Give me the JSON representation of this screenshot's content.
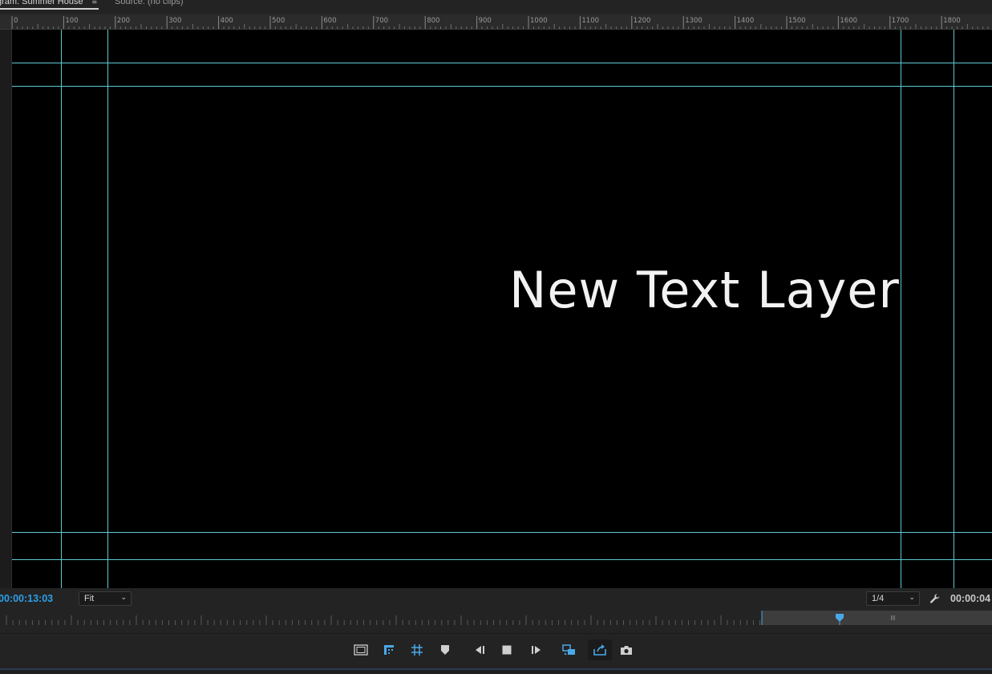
{
  "tabs": {
    "program_label": "gram: Summer House",
    "program_menu_icon": "hamburger-menu-icon",
    "source_label": "Source: (no clips)"
  },
  "ruler": {
    "labels": [
      "0",
      "100",
      "200",
      "300",
      "400",
      "500",
      "600",
      "700",
      "800",
      "900",
      "1000",
      "1100",
      "1200",
      "1300",
      "1400",
      "1500",
      "1600",
      "1700",
      "1800"
    ]
  },
  "canvas": {
    "text_layer": "New Text Layer",
    "background": "#000000",
    "guide_color": "#5fc9d2"
  },
  "controls": {
    "playhead_timecode": "00:00:13:03",
    "zoom_value": "Fit",
    "resolution_value": "1/4",
    "duration_timecode": "00:00:04",
    "settings_icon": "wrench-icon",
    "timecode_color": "#2d9fe8"
  },
  "transport": {
    "buttons": [
      {
        "name": "safe-margins-icon"
      },
      {
        "name": "add-marker-icon"
      },
      {
        "name": "grid-icon"
      },
      {
        "name": "marker-icon"
      },
      {
        "name": "step-back-icon"
      },
      {
        "name": "stop-icon"
      },
      {
        "name": "step-forward-icon"
      },
      {
        "name": "loop-icon"
      },
      {
        "name": "export-frame-icon"
      },
      {
        "name": "camera-icon"
      }
    ],
    "accent_color": "#4aa8e8"
  }
}
